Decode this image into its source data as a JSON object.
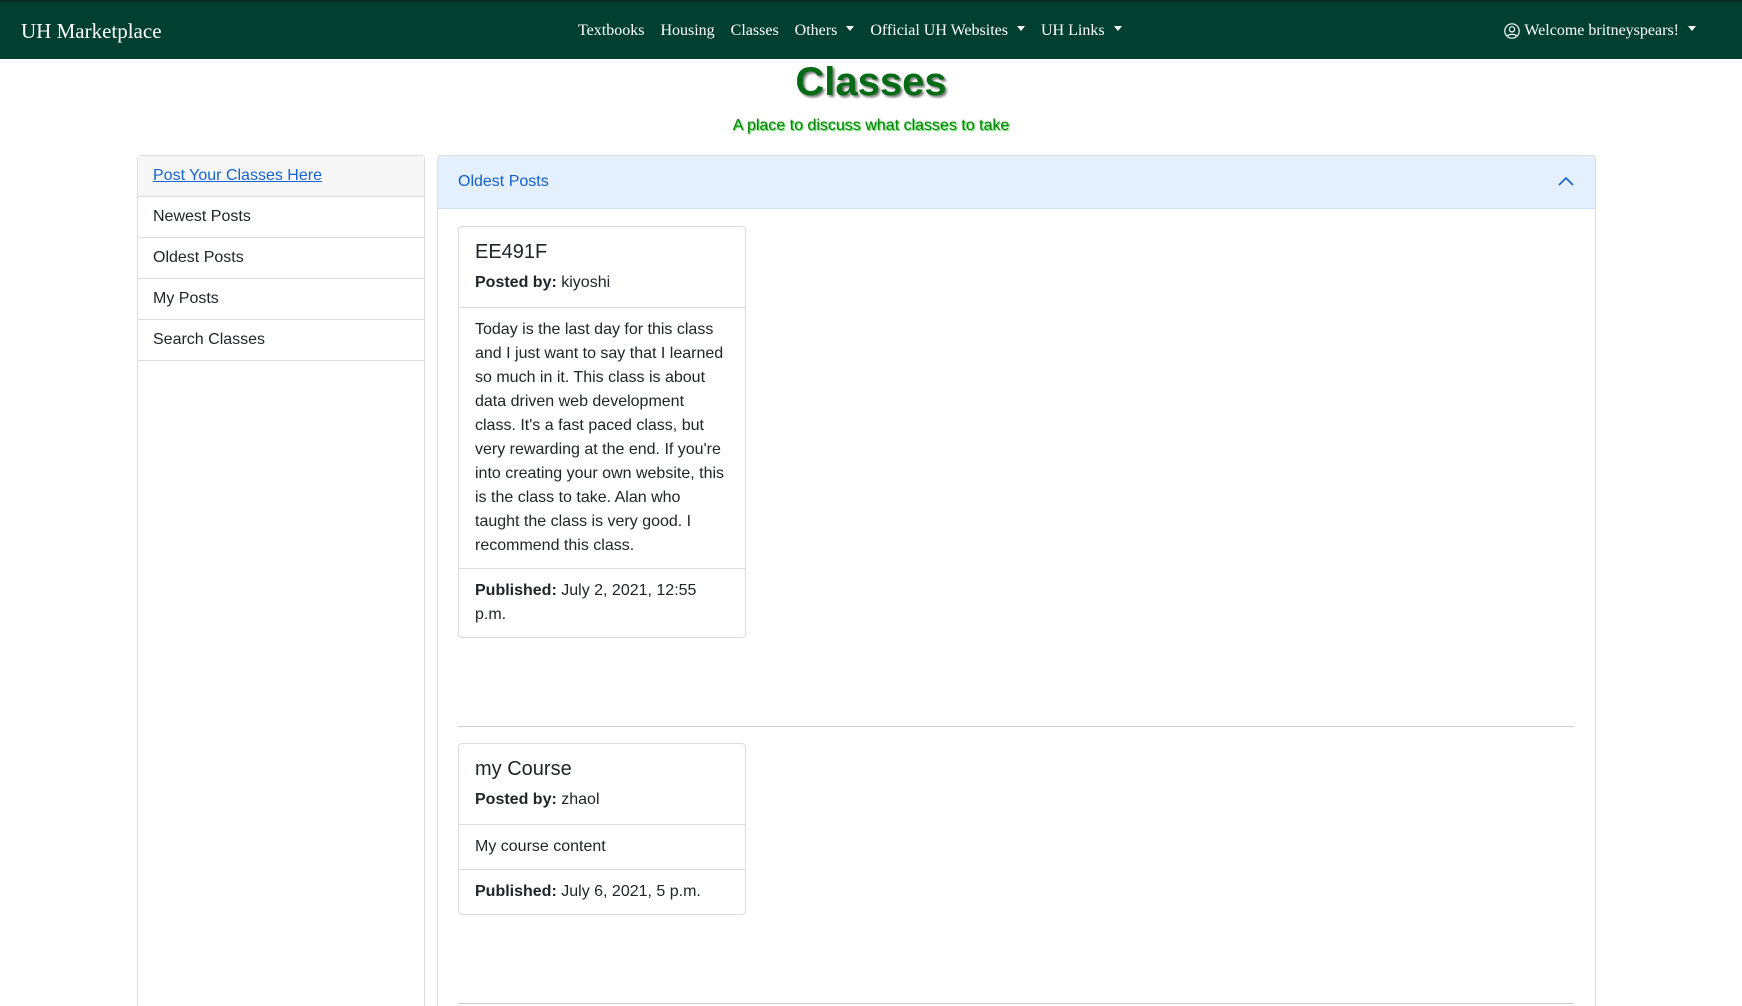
{
  "navbar": {
    "brand": "UH Marketplace",
    "items": [
      {
        "label": "Textbooks",
        "dropdown": false
      },
      {
        "label": "Housing",
        "dropdown": false
      },
      {
        "label": "Classes",
        "dropdown": false
      },
      {
        "label": "Others",
        "dropdown": true
      },
      {
        "label": "Official UH Websites",
        "dropdown": true
      },
      {
        "label": "UH Links",
        "dropdown": true
      }
    ],
    "user_label": "Welcome britneyspears!",
    "bg_color": "#013f30"
  },
  "page": {
    "title": "Classes",
    "subtitle": "A place to discuss what classes to take"
  },
  "sidebar": {
    "header_link": "Post Your Classes Here",
    "items": [
      "Newest Posts",
      "Oldest Posts",
      "My Posts",
      "Search Classes"
    ]
  },
  "main": {
    "header": "Oldest Posts",
    "posts": [
      {
        "title": "EE491F",
        "posted_by_label": "Posted by:",
        "author": "kiyoshi",
        "body": "Today is the last day for this class and I just want to say that I learned so much in it. This class is about data driven web development class. It's a fast paced class, but very rewarding at the end. If you're into creating your own website, this is the class to take. Alan who taught the class is very good. I recommend this class.",
        "published_label": "Published:",
        "published": "July 2, 2021, 12:55 p.m."
      },
      {
        "title": "my Course",
        "posted_by_label": "Posted by:",
        "author": "zhaol",
        "body": "My course content",
        "published_label": "Published:",
        "published": "July 6, 2021, 5 p.m."
      }
    ]
  }
}
